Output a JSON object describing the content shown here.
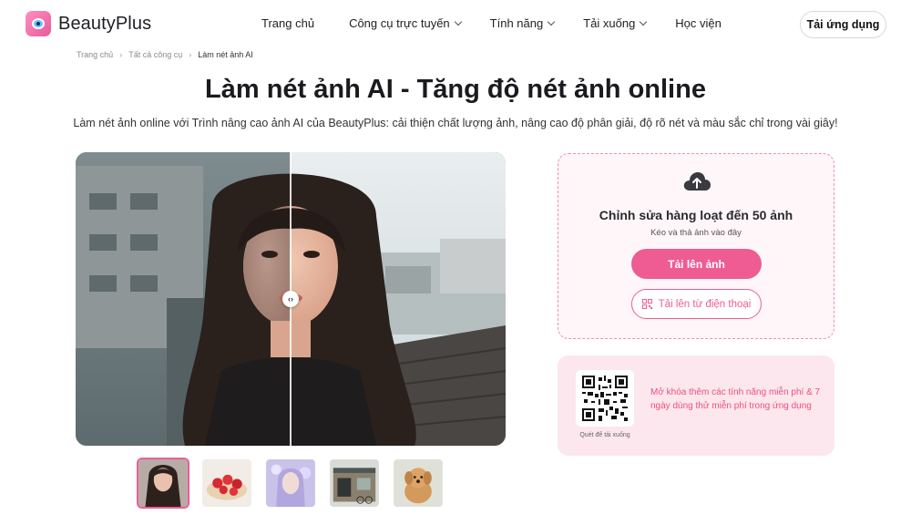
{
  "header": {
    "brand": "BeautyPlus",
    "nav": [
      {
        "label": "Trang chủ",
        "dropdown": false
      },
      {
        "label": "Công cụ trực tuyến",
        "dropdown": true
      },
      {
        "label": "Tính năng",
        "dropdown": true
      },
      {
        "label": "Tải xuống",
        "dropdown": true
      },
      {
        "label": "Học viện",
        "dropdown": false
      }
    ],
    "download_label": "Tải ứng dụng"
  },
  "breadcrumb": {
    "home": "Trang chủ",
    "tools": "Tất cả công cụ",
    "current": "Làm nét ảnh AI"
  },
  "hero": {
    "title": "Làm nét ảnh AI - Tăng độ nét ảnh online",
    "subtitle": "Làm nét ảnh online với Trình nâng cao ảnh AI của BeautyPlus: cải thiện chất lượng ảnh, nâng cao độ phân giải, độ rõ nét và màu sắc chỉ trong vài giây!"
  },
  "compare": {
    "handle_icon": "‹›",
    "slider_position": 0.5
  },
  "thumbnails": [
    {
      "name": "portrait-girl",
      "active": true
    },
    {
      "name": "strawberry-cake",
      "active": false
    },
    {
      "name": "fantasy-portrait",
      "active": false
    },
    {
      "name": "storefront",
      "active": false
    },
    {
      "name": "puppy",
      "active": false
    }
  ],
  "upload": {
    "title": "Chỉnh sửa hàng loạt đến 50 ảnh",
    "hint": "Kéo và thả ảnh vào đây",
    "upload_button": "Tải lên ảnh",
    "phone_button": "Tải lên từ điện thoại"
  },
  "promo": {
    "qr_caption": "Quét để tải xuống",
    "text": "Mở khóa thêm các tính năng miễn phí & 7 ngày dùng thử miễn phí trong ứng dụng"
  },
  "colors": {
    "accent": "#ee5c93",
    "promo_bg": "#fde7ef",
    "upload_bg": "#fff6f9"
  }
}
